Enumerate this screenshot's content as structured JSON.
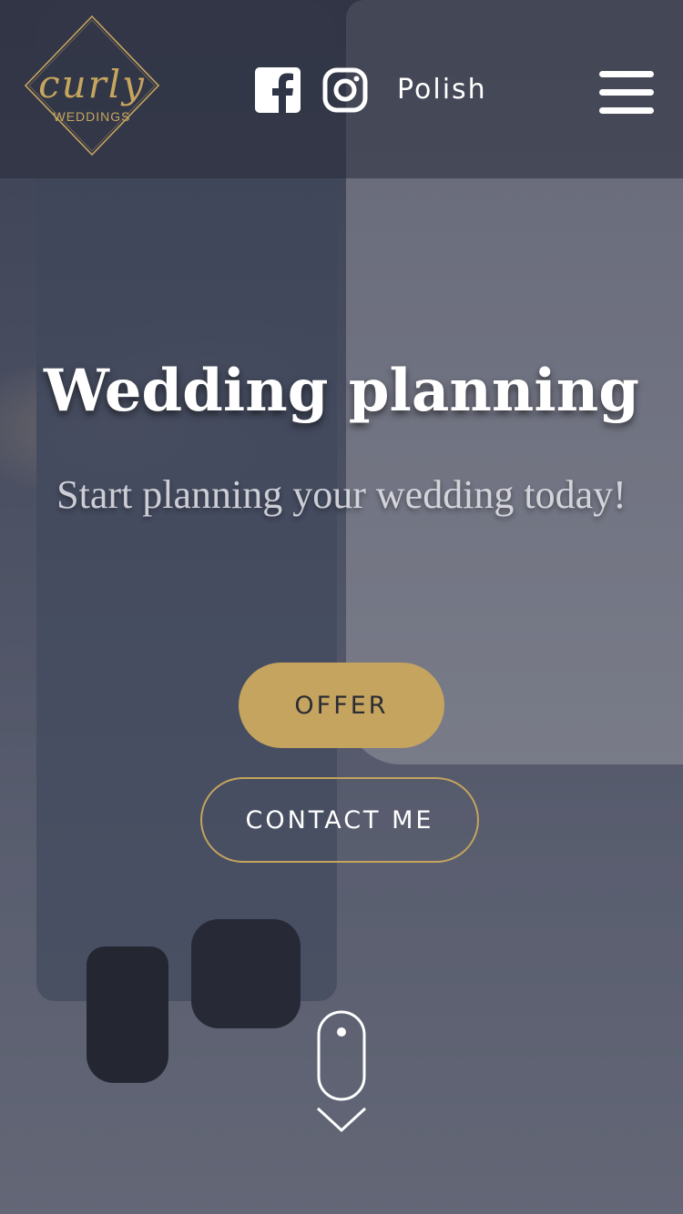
{
  "header": {
    "logo": {
      "script": "curly",
      "sub": "WEDDINGS"
    },
    "social": [
      {
        "icon": "facebook-icon"
      },
      {
        "icon": "instagram-icon"
      }
    ],
    "language_label": "Polish",
    "menu_icon": "hamburger-menu-icon"
  },
  "hero": {
    "title": "Wedding planning",
    "subtitle": "Start planning your wedding today!",
    "offer_button": "OFFER",
    "contact_button": "CONTACT ME",
    "scroll_icon": "scroll-down-icon"
  },
  "colors": {
    "accent": "#c4a45e",
    "header_overlay": "#282c3a",
    "text": "#ffffff"
  }
}
